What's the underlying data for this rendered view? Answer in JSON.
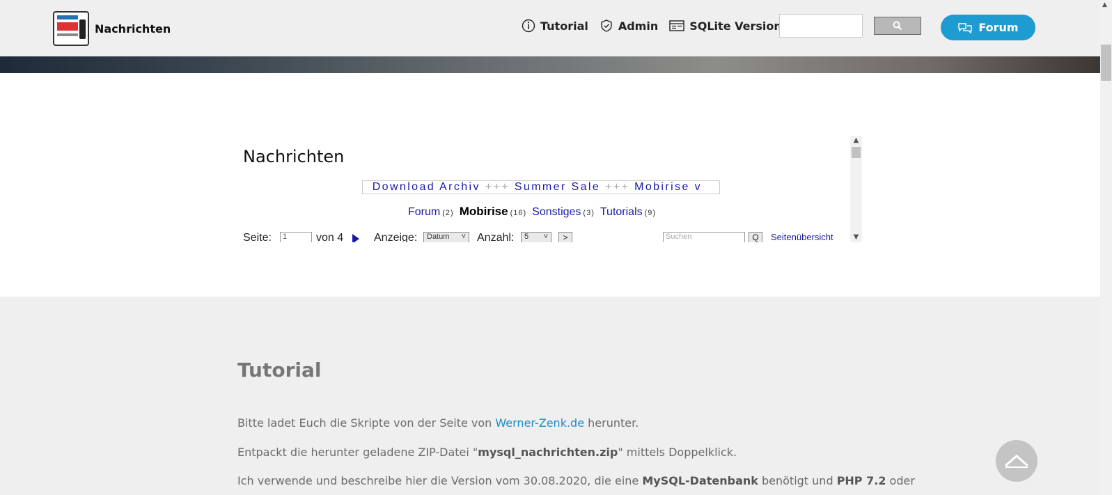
{
  "brand": {
    "title": "Nachrichten"
  },
  "nav": {
    "tutorial": "Tutorial",
    "admin": "Admin",
    "sqlite": "SQLite Version",
    "forum": "Forum"
  },
  "frame": {
    "title": "Nachrichten",
    "ticker": [
      "Download Archiv",
      "+++",
      "Summer Sale",
      "+++",
      "Mobirise v"
    ],
    "categories": [
      {
        "label": "Forum",
        "count": "(2)"
      },
      {
        "label": "Mobirise",
        "count": "(16)",
        "active": true
      },
      {
        "label": "Sonstiges",
        "count": "(3)"
      },
      {
        "label": "Tutorials",
        "count": "(9)"
      }
    ],
    "controls": {
      "page_label": "Seite:",
      "page_value": "1",
      "of_label": "von 4",
      "display_label": "Anzeige:",
      "display_value": "Datum",
      "count_label": "Anzahl:",
      "count_value": "5",
      "go": ">",
      "search_placeholder": "Suchen",
      "search_btn": "Q",
      "overview": "Seitenübersicht"
    }
  },
  "tutorial": {
    "heading": "Tutorial",
    "p1_pre": "Bitte ladet Euch die Skripte von der Seite von ",
    "p1_link": "Werner-Zenk.de",
    "p1_post": " herunter.",
    "p2_pre": "Entpackt die herunter geladene ZIP-Datei \"",
    "p2_bold": "mysql_nachrichten.zip",
    "p2_post": "\" mittels Doppelklick.",
    "p3_pre": "Ich verwende und beschreibe hier die Version vom 30.08.2020, die eine ",
    "p3_b1": "MySQL-Datenbank",
    "p3_mid": " benötigt und ",
    "p3_b2": "PHP 7.2",
    "p3_post": " oder"
  },
  "colors": {
    "accent": "#1e9bd0",
    "link": "#1a1aa6"
  }
}
